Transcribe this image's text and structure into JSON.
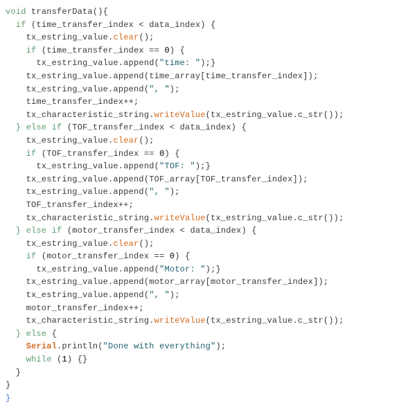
{
  "code": {
    "func_decl_type": "void",
    "func_decl_name": " transferData(){",
    "if1_open": "  if",
    "if1_cond": " (time_transfer_index < data_index) {",
    "clear_call_a": "    tx_estring_value.",
    "clear_method": "clear",
    "clear_call_b": "();",
    "if1a_open": "    if",
    "if1a_cond": " (time_transfer_index == ",
    "zero": "0",
    "if1a_cond2": ") {",
    "append_time_a": "      tx_estring_value.append(",
    "str_time": "\"time: \"",
    "append_time_b": ");}",
    "append_arr1": "    tx_estring_value.append(time_array[time_transfer_index]);",
    "append_comma_a": "    tx_estring_value.append(",
    "str_comma": "\", \"",
    "append_comma_b": ");",
    "inc1": "    time_transfer_index++;",
    "write_a": "    tx_characteristic_string.",
    "write_method": "writeValue",
    "write_b": "(tx_estring_value.c_str());",
    "elseif2": "  } else if",
    "elseif2_cond": " (TOF_transfer_index < data_index) {",
    "if2a_open": "    if",
    "if2a_cond": " (TOF_transfer_index == ",
    "if2a_cond2": ") {",
    "append_tof_a": "      tx_estring_value.append(",
    "str_tof": "\"TOF: \"",
    "append_tof_b": ");}",
    "append_arr2": "    tx_estring_value.append(TOF_array[TOF_transfer_index]);",
    "inc2": "    TOF_transfer_index++;",
    "elseif3": "  } else if",
    "elseif3_cond": " (motor_transfer_index < data_index) {",
    "if3a_open": "    if",
    "if3a_cond": " (motor_transfer_index == ",
    "if3a_cond2": ") {",
    "append_motor_a": "      tx_estring_value.append(",
    "str_motor": "\"Motor: \"",
    "append_motor_b": ");}",
    "append_arr3": "    tx_estring_value.append(motor_array[motor_transfer_index]);",
    "inc3": "    motor_transfer_index++;",
    "else_open": "  } else",
    "else_brace": " {",
    "serial_a": "    ",
    "serial_obj": "Serial",
    "serial_b": ".println(",
    "str_done": "\"Done with everything\"",
    "serial_c": ");",
    "while_kw": "    while",
    "while_rest": " (",
    "one": "1",
    "while_rest2": ") {}",
    "close1": "  }",
    "close2": "}",
    "close3": "}"
  }
}
